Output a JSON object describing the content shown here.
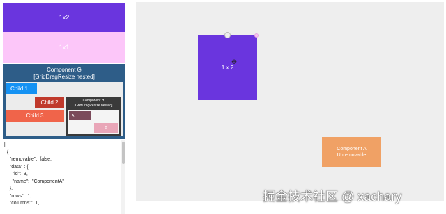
{
  "sidebar": {
    "block_1x2": "1x2",
    "block_1x1": "1x1",
    "component_g": {
      "title": "Component G",
      "subtitle": "[GridDragResize nested]",
      "children": [
        "Child 1",
        "Child 2",
        "Child 3"
      ],
      "component_h": {
        "title": "Component H",
        "subtitle": "[GridDragResize nested]",
        "item_a": "A",
        "item_b": "B"
      }
    },
    "json_lines": [
      "[",
      "  {",
      "    \"removable\":  false,",
      "    \"data\" : {",
      "      \"id\":  3,",
      "      \"name\":  \"ComponentA\"",
      "    },",
      "    \"rows\":  1,",
      "    \"columns\":  1,"
    ]
  },
  "canvas": {
    "dragging_block_label": "1 x 2",
    "component_a": {
      "title": "Component A",
      "status": "Unremovable"
    },
    "watermark": "掘金技术社区 @ xachary"
  },
  "colors": {
    "purple": "#6a35de",
    "pink": "#fcc6f9",
    "navy": "#2e5d88",
    "blue": "#1592f3",
    "red": "#c0392b",
    "coral": "#f0644a",
    "orange": "#f0a165"
  }
}
